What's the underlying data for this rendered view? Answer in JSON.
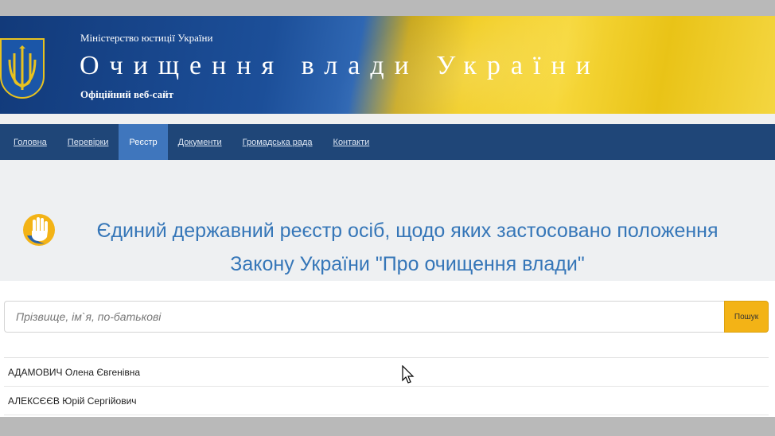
{
  "header": {
    "ministry": "Міністерство юстиції України",
    "title": "Очищення влади України",
    "subtitle": "Офіційний веб-сайт"
  },
  "nav": {
    "items": [
      {
        "label": "Головна"
      },
      {
        "label": "Перевірки"
      },
      {
        "label": "Реєстр"
      },
      {
        "label": "Документи"
      },
      {
        "label": "Громадська рада"
      },
      {
        "label": "Контакти"
      }
    ]
  },
  "registry": {
    "heading_line1": "Єдиний державний реєстр осіб, щодо яких застосовано положення",
    "heading_line2": "Закону України \"Про очищення влади\""
  },
  "search": {
    "placeholder": "Прізвище, ім`я, по-батькові",
    "button_label": "Пошук"
  },
  "results": [
    {
      "name": "АДАМОВИЧ Олена Євгенівна"
    },
    {
      "name": "АЛЕКСЄЄВ Юрій Сергійович"
    }
  ],
  "colors": {
    "nav_bg": "#1f4678",
    "nav_active": "#3f76bd",
    "heading": "#3576b8",
    "search_button": "#f3b316"
  }
}
